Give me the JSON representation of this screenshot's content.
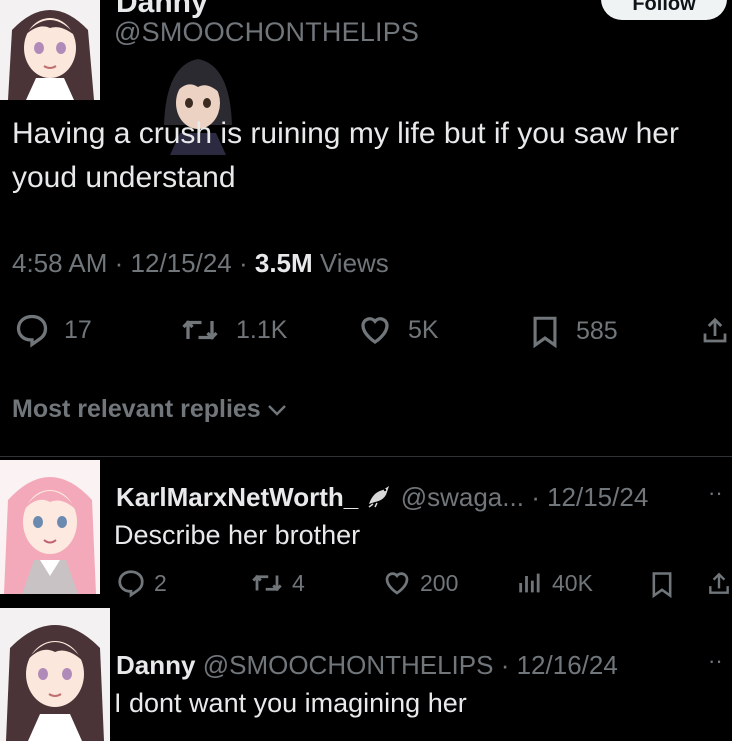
{
  "tweet": {
    "author_name_partial": "Danny",
    "handle": "@SMOOCHONTHELIPS",
    "follow_label": "Follow",
    "text": "Having a crush is ruining my life but if you saw her youd understand",
    "time": "4:58 AM",
    "date": "12/15/24",
    "views_count": "3.5M",
    "views_label": "Views",
    "replies": "17",
    "reposts": "1.1K",
    "likes": "5K",
    "bookmarks": "585"
  },
  "replies_header": "Most relevant replies",
  "replies": [
    {
      "name": "KarlMarxNetWorth_",
      "handle": "@swaga...",
      "date": "12/15/24",
      "text": "Describe her brother",
      "replies": "2",
      "reposts": "4",
      "likes": "200",
      "views": "40K"
    },
    {
      "name": "Danny",
      "handle": "@SMOOCHONTHELIPS",
      "date": "12/16/24",
      "text": "I dont want you imagining her"
    }
  ],
  "colors": {
    "background": "#000000",
    "text": "#e7e9ea",
    "muted": "#71767b",
    "divider": "#2f3336"
  }
}
